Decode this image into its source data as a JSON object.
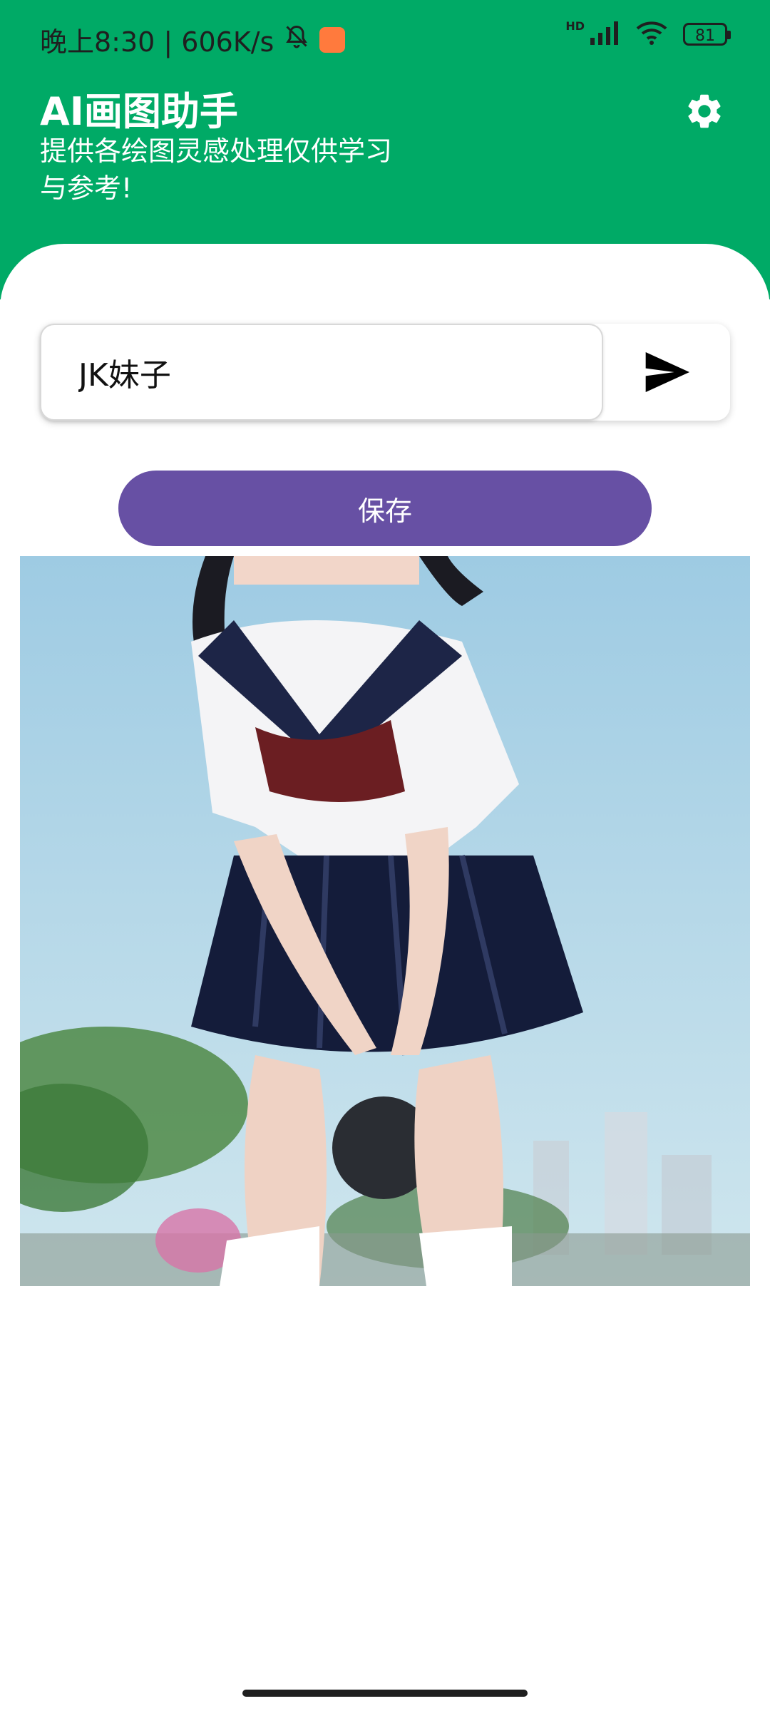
{
  "status_bar": {
    "time_and_speed": "晚上8:30 | 606K/s",
    "network_label": "HD",
    "battery_level": "81"
  },
  "header": {
    "title": "AI画图助手",
    "subtitle": "提供各绘图灵感处理仅供学习与参考!"
  },
  "prompt": {
    "value": "JK妹子"
  },
  "actions": {
    "save_label": "保存"
  },
  "colors": {
    "header_bg": "#00AA66",
    "save_button_bg": "#6750A4"
  },
  "icons": {
    "settings": "gear-icon",
    "send": "send-icon",
    "mute": "bell-off-icon"
  }
}
